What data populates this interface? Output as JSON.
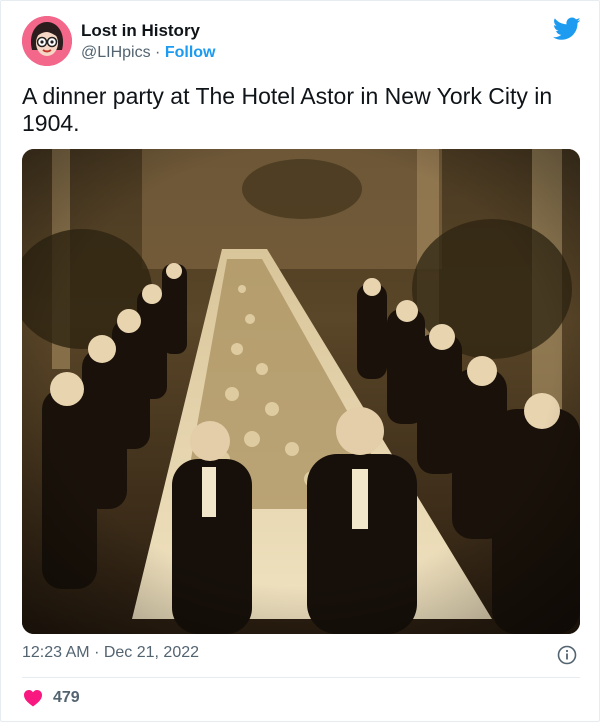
{
  "author": {
    "name": "Lost in History",
    "handle": "@LIHpics",
    "separator": "·",
    "follow_label": "Follow"
  },
  "tweet": {
    "text": "A dinner party at The Hotel Astor in New York City in 1904.",
    "time": "12:23 AM",
    "date": "Dec 21, 2022",
    "likes": "479"
  },
  "icons": {
    "brand": "twitter-bird-icon",
    "info": "info-icon",
    "like": "heart-icon"
  },
  "colors": {
    "accent": "#1d9bf0",
    "heart": "#f91880",
    "avatar_bg": "#f05a7e",
    "photo_tone": "#3c2c18"
  }
}
